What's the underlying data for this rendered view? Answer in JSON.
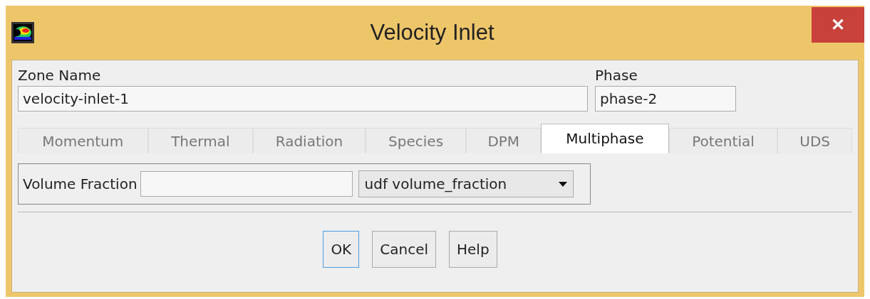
{
  "window": {
    "title": "Velocity Inlet",
    "close": "✕"
  },
  "zone_name": {
    "label": "Zone Name",
    "value": "velocity-inlet-1"
  },
  "phase": {
    "label": "Phase",
    "value": "phase-2"
  },
  "tabs": [
    {
      "label": "Momentum",
      "selected": false
    },
    {
      "label": "Thermal",
      "selected": false
    },
    {
      "label": "Radiation",
      "selected": false
    },
    {
      "label": "Species",
      "selected": false
    },
    {
      "label": "DPM",
      "selected": false
    },
    {
      "label": "Multiphase",
      "selected": true
    },
    {
      "label": "Potential",
      "selected": false
    },
    {
      "label": "UDS",
      "selected": false
    }
  ],
  "volume_fraction": {
    "label": "Volume Fraction",
    "option": "udf volume_fraction"
  },
  "buttons": [
    {
      "label": "OK",
      "focused": true
    },
    {
      "label": "Cancel",
      "focused": false
    },
    {
      "label": "Help",
      "focused": false
    }
  ]
}
